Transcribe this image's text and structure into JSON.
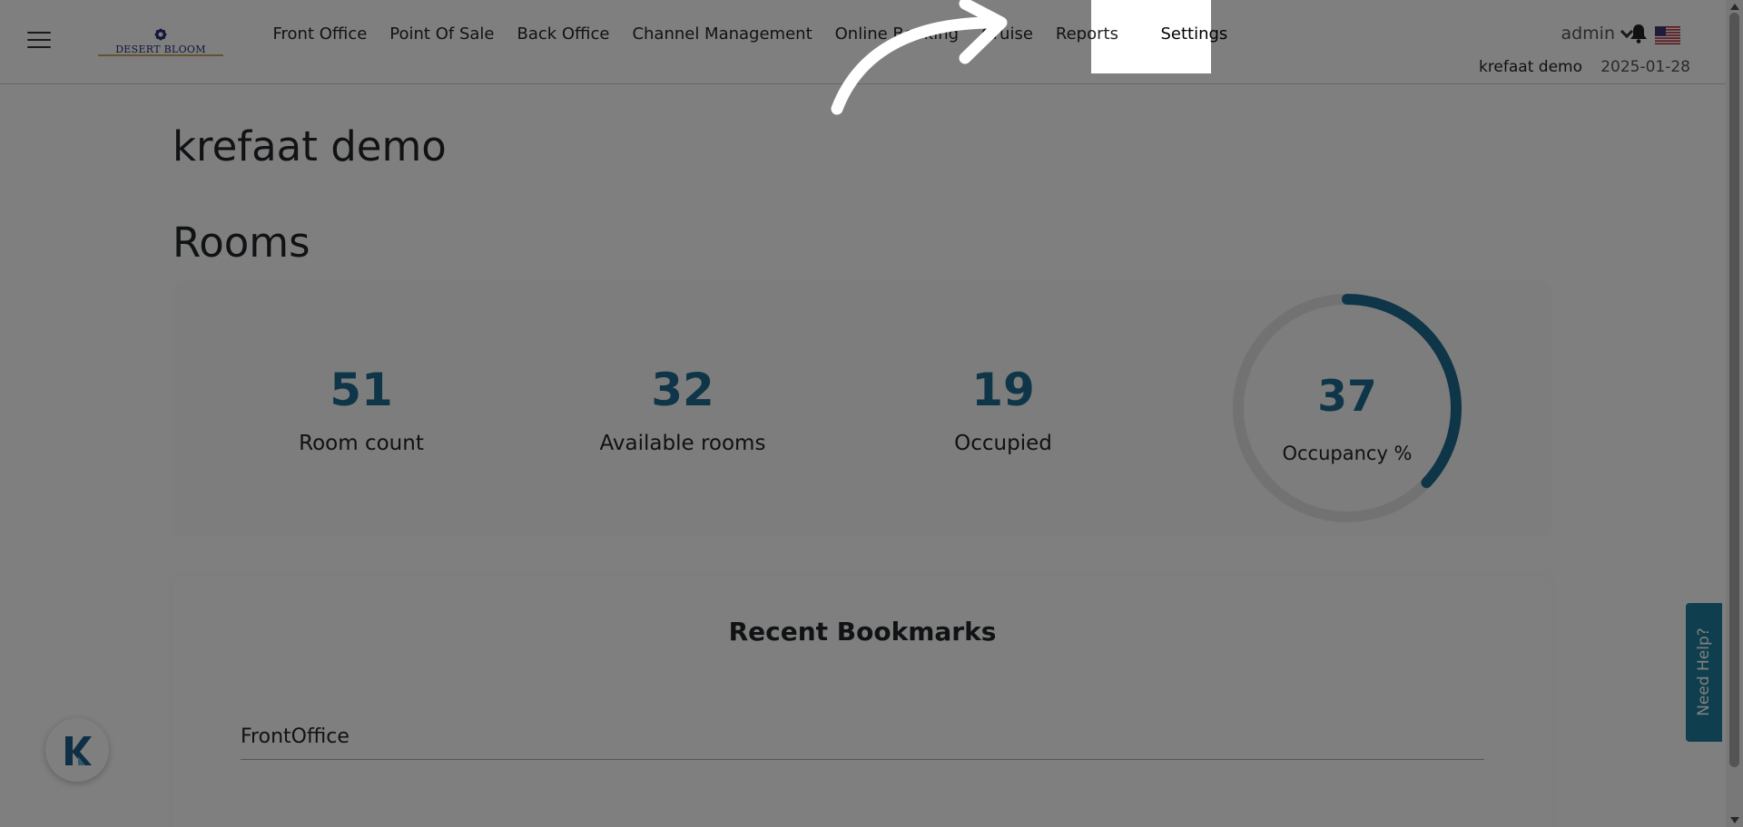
{
  "brand": {
    "logo_text": "DESERT BLOOM"
  },
  "nav": {
    "items": [
      {
        "label": "Front Office"
      },
      {
        "label": "Point Of Sale"
      },
      {
        "label": "Back Office"
      },
      {
        "label": "Channel Management"
      },
      {
        "label": "Online Booking"
      },
      {
        "label": "Cruise"
      },
      {
        "label": "Reports"
      },
      {
        "label": "Settings",
        "active": true
      }
    ]
  },
  "user": {
    "name": "admin",
    "hotel": "krefaat demo",
    "date": "2025-01-28",
    "language_flag": "us-flag-icon"
  },
  "page": {
    "title": "krefaat demo"
  },
  "rooms": {
    "section_title": "Rooms",
    "stats": [
      {
        "value": "51",
        "label": "Room count"
      },
      {
        "value": "32",
        "label": "Available rooms"
      },
      {
        "value": "19",
        "label": "Occupied"
      }
    ],
    "occupancy": {
      "value": "37",
      "label": "Occupancy %",
      "percent": 37
    }
  },
  "bookmarks": {
    "title": "Recent Bookmarks",
    "items": [
      {
        "label": "FrontOffice"
      }
    ]
  },
  "help": {
    "label": "Need Help?"
  },
  "colors": {
    "accent": "#1f6d91",
    "help_tab": "#1e7f9d",
    "ring_track": "#e5e5e5"
  }
}
